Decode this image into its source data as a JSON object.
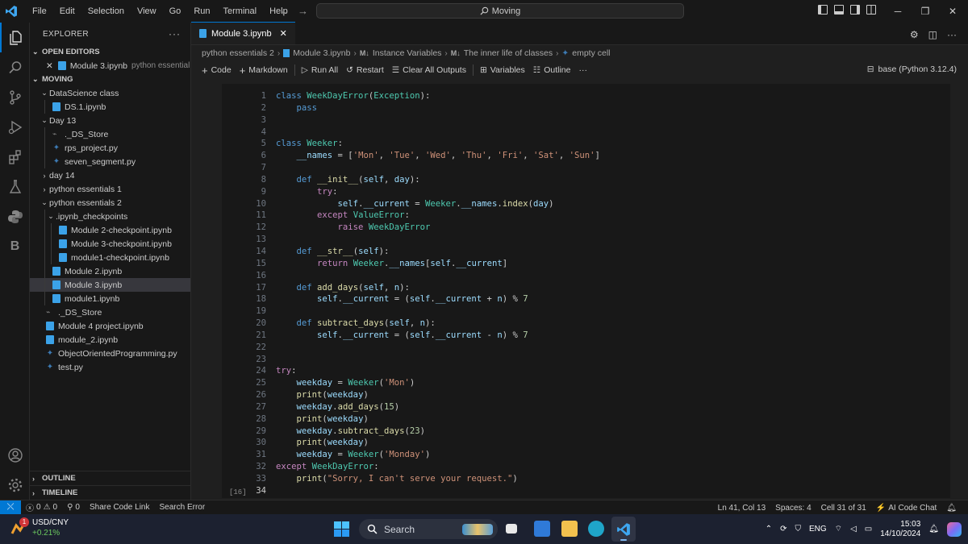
{
  "titlebar": {
    "menu": [
      "File",
      "Edit",
      "Selection",
      "View",
      "Go",
      "Run",
      "Terminal",
      "Help"
    ],
    "search_text": "Moving"
  },
  "sidebar": {
    "header": "EXPLORER",
    "open_editors_label": "OPEN EDITORS",
    "open_editor": {
      "name": "Module 3.ipynb",
      "desc": "python essential..."
    },
    "root_label": "MOVING",
    "tree": [
      {
        "label": "DataScience class",
        "type": "folder-open",
        "depth": 0
      },
      {
        "label": "DS.1.ipynb",
        "type": "nb",
        "depth": 1
      },
      {
        "label": "Day 13",
        "type": "folder-open",
        "depth": 0
      },
      {
        "label": "._DS_Store",
        "type": "ds",
        "depth": 1
      },
      {
        "label": "rps_project.py",
        "type": "py",
        "depth": 1
      },
      {
        "label": "seven_segment.py",
        "type": "py",
        "depth": 1
      },
      {
        "label": "day 14",
        "type": "folder",
        "depth": 0
      },
      {
        "label": "python essentials 1",
        "type": "folder",
        "depth": 0
      },
      {
        "label": "python essentials 2",
        "type": "folder-open",
        "depth": 0
      },
      {
        "label": ".ipynb_checkpoints",
        "type": "folder-open",
        "depth": 1
      },
      {
        "label": "Module 2-checkpoint.ipynb",
        "type": "nb",
        "depth": 2
      },
      {
        "label": "Module 3-checkpoint.ipynb",
        "type": "nb",
        "depth": 2
      },
      {
        "label": "module1-checkpoint.ipynb",
        "type": "nb",
        "depth": 2
      },
      {
        "label": "Module 2.ipynb",
        "type": "nb",
        "depth": 1
      },
      {
        "label": "Module 3.ipynb",
        "type": "nb",
        "depth": 1,
        "selected": true
      },
      {
        "label": "module1.ipynb",
        "type": "nb",
        "depth": 1
      },
      {
        "label": "._DS_Store",
        "type": "ds",
        "depth": 0
      },
      {
        "label": "Module 4 project.ipynb",
        "type": "nb",
        "depth": 0
      },
      {
        "label": "module_2.ipynb",
        "type": "nb",
        "depth": 0
      },
      {
        "label": "ObjectOrientedProgramming.py",
        "type": "py",
        "depth": 0
      },
      {
        "label": "test.py",
        "type": "py",
        "depth": 0
      }
    ],
    "outline_label": "OUTLINE",
    "timeline_label": "TIMELINE"
  },
  "editor": {
    "tab_label": "Module 3.ipynb",
    "breadcrumb": [
      "python essentials 2",
      "Module 3.ipynb",
      "Instance Variables",
      "The inner life of classes",
      "empty cell"
    ],
    "toolbar": {
      "code": "Code",
      "markdown": "Markdown",
      "run_all": "Run All",
      "restart": "Restart",
      "clear": "Clear All Outputs",
      "variables": "Variables",
      "outline": "Outline",
      "more": "···"
    },
    "kernel": "base (Python 3.12.4)",
    "exec_count": "[16]",
    "current_line": 34
  },
  "status": {
    "errors": "0",
    "warnings": "0",
    "ports": "0",
    "share": "Share Code Link",
    "search_error": "Search Error",
    "position": "Ln 41, Col 13",
    "spaces": "Spaces: 4",
    "cell": "Cell 31 of 31",
    "ai": "AI Code Chat"
  },
  "taskbar": {
    "weather_title": "USD/CNY",
    "weather_value": "+0.21%",
    "weather_badge": "1",
    "search_label": "Search",
    "lang": "ENG",
    "time": "15:03",
    "date": "14/10/2024"
  },
  "colors": {
    "accent": "#0078d4",
    "taskbar": "#1c2130",
    "positive": "#6ccb5f"
  }
}
